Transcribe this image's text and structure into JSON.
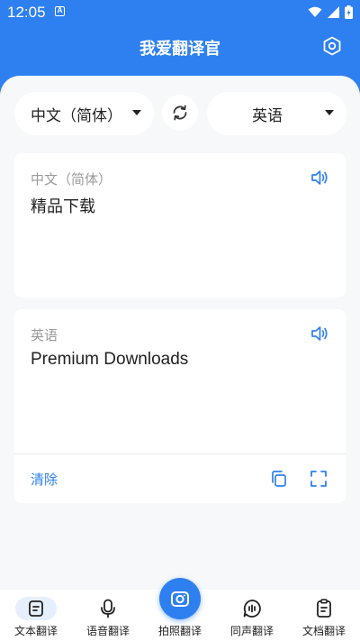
{
  "status_bar": {
    "time": "12:05",
    "badge": "A"
  },
  "header": {
    "title": "我爱翻译官"
  },
  "lang_selector": {
    "source": "中文（简体）",
    "target": "英语"
  },
  "source_card": {
    "language": "中文（简体）",
    "text": "精品下载"
  },
  "target_card": {
    "language": "英语",
    "text": "Premium Downloads",
    "clear_label": "清除"
  },
  "tabs": [
    {
      "label": "文本翻译",
      "icon": "text-doc-icon"
    },
    {
      "label": "语音翻译",
      "icon": "microphone-icon"
    },
    {
      "label": "拍照翻译",
      "icon": "camera-icon"
    },
    {
      "label": "同声翻译",
      "icon": "simultaneous-icon"
    },
    {
      "label": "文档翻译",
      "icon": "clipboard-doc-icon"
    }
  ],
  "colors": {
    "accent": "#2e80f0",
    "background": "#f7f8fa",
    "active_tab_bg": "#e6effc"
  }
}
